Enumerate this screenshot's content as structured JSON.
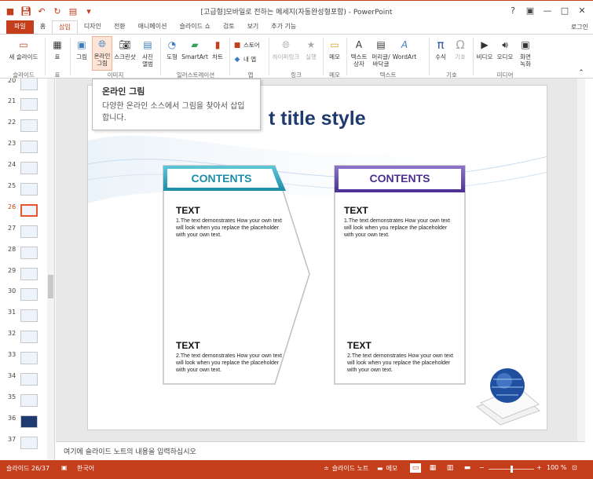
{
  "window": {
    "title": "[고급형]모바일로 전하는 메세지(자동완성형포함) - PowerPoint",
    "controls": {
      "help": "?",
      "restore": "▣",
      "minimize": "—",
      "maximize": "□",
      "close": "✕"
    }
  },
  "tabs": [
    {
      "label": "파일"
    },
    {
      "label": "홈"
    },
    {
      "label": "삽입"
    },
    {
      "label": "디자인"
    },
    {
      "label": "전환"
    },
    {
      "label": "애니메이션"
    },
    {
      "label": "슬라이드 쇼"
    },
    {
      "label": "검토"
    },
    {
      "label": "보기"
    },
    {
      "label": "추가 기능"
    }
  ],
  "login_label": "로그인",
  "ribbon": {
    "new_slide": "새 슬라이드",
    "table": "표",
    "picture": "그림",
    "online_picture": "온라인 그림",
    "screenshot": "스크린샷",
    "photo_album": "사진 앨범",
    "shapes": "도형",
    "smartart": "SmartArt",
    "chart": "차트",
    "store": "스토어",
    "my_apps": "내 앱",
    "hyperlink": "하이퍼링크",
    "action": "실행",
    "comment": "메모",
    "textbox": "텍스트 상자",
    "header_footer": "머리글/ 바닥글",
    "wordart": "WordArt",
    "equation": "수식",
    "symbol": "기호",
    "video": "비디오",
    "audio": "오디오",
    "screen_recording": "화면 녹화",
    "groups": {
      "slides": "슬라이드",
      "tables": "표",
      "images": "이미지",
      "illustrations": "일러스트레이션",
      "apps": "앱",
      "links": "링크",
      "comments": "메모",
      "text": "텍스트",
      "symbols": "기호",
      "media": "미디어"
    }
  },
  "tooltip": {
    "title": "온라인 그림",
    "body": "다양한 온라인 소스에서 그림을 찾아서 삽입합니다."
  },
  "thumbnails": [
    {
      "num": "20"
    },
    {
      "num": "21"
    },
    {
      "num": "22"
    },
    {
      "num": "23"
    },
    {
      "num": "24"
    },
    {
      "num": "25"
    },
    {
      "num": "26"
    },
    {
      "num": "27"
    },
    {
      "num": "28"
    },
    {
      "num": "29"
    },
    {
      "num": "30"
    },
    {
      "num": "31"
    },
    {
      "num": "32"
    },
    {
      "num": "33"
    },
    {
      "num": "34"
    },
    {
      "num": "35"
    },
    {
      "num": "36"
    },
    {
      "num": "37"
    }
  ],
  "selected_slide": "26",
  "slide": {
    "title_visible": "t title style",
    "left_panel": {
      "header": "CONTENTS",
      "block1_head": "TEXT",
      "block1_body": "1.The text demonstrates How your own text will look when you replace the placeholder with your own text.",
      "block2_head": "TEXT",
      "block2_body": "2.The text demonstrates How your own text will look when you replace the placeholder with your own text."
    },
    "right_panel": {
      "header": "CONTENTS",
      "block1_head": "TEXT",
      "block1_body": "1.The text demonstrates How your own text will look when you replace the placeholder with your own text.",
      "block2_head": "TEXT",
      "block2_body": "2.The text demonstrates How your own text will look when you replace the placeholder with your own text."
    }
  },
  "notes_placeholder": "여기에 슬라이드 노트의 내용을 입력하십시오",
  "status": {
    "slide_count": "슬라이드 26/37",
    "language": "한국어",
    "notes": "슬라이드 노트",
    "comments": "메모",
    "zoom": "100 %",
    "zoom_level": 0.5
  },
  "colors": {
    "accent": "#c43e1c",
    "teal": "#2a9fb6",
    "purple": "#5a3f9e",
    "title": "#1f3a6e"
  }
}
